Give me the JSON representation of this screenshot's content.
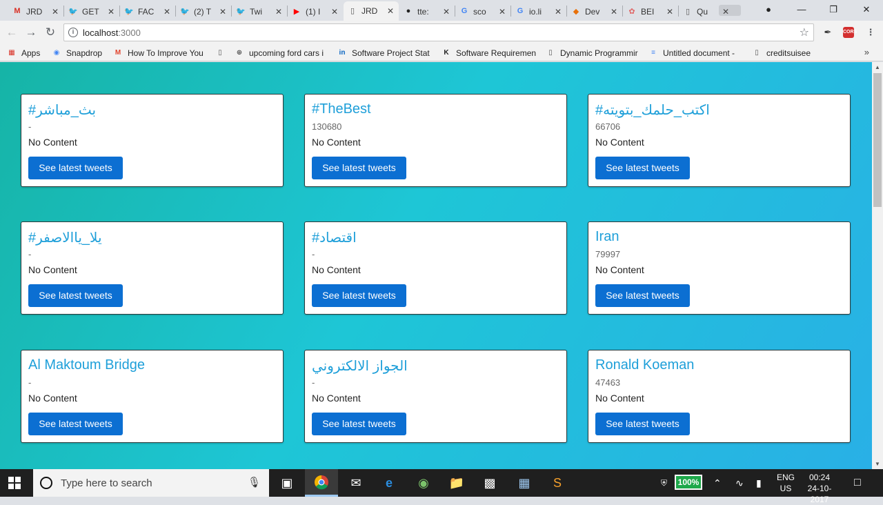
{
  "tabs": [
    {
      "title": "JRD",
      "icon": "M",
      "icon_color": "#d93025"
    },
    {
      "title": "GET",
      "icon": "🐦",
      "icon_color": "#1da1f2"
    },
    {
      "title": "FAC",
      "icon": "🐦",
      "icon_color": "#1da1f2"
    },
    {
      "title": "(2) T",
      "icon": "🐦",
      "icon_color": "#1da1f2"
    },
    {
      "title": "Twi",
      "icon": "🐦",
      "icon_color": "#1da1f2"
    },
    {
      "title": "(1) I",
      "icon": "▶",
      "icon_color": "#ff0000"
    },
    {
      "title": "JRD",
      "icon": "▯",
      "icon_color": "#555"
    },
    {
      "title": "tte:",
      "icon": "●",
      "icon_color": "#222"
    },
    {
      "title": "sco",
      "icon": "G",
      "icon_color": "#4285f4"
    },
    {
      "title": "io.li",
      "icon": "G",
      "icon_color": "#4285f4"
    },
    {
      "title": "Dev",
      "icon": "◆",
      "icon_color": "#e8710a"
    },
    {
      "title": "BEI",
      "icon": "✿",
      "icon_color": "#e06666"
    },
    {
      "title": "Qu",
      "icon": "▯",
      "icon_color": "#555"
    }
  ],
  "omnibox": {
    "host": "localhost",
    "path": ":3000"
  },
  "extensions": {
    "cors": "CORS"
  },
  "bookmarks": [
    {
      "label": "Apps",
      "icon": "▦",
      "icon_color": "#d93025"
    },
    {
      "label": "Snapdrop",
      "icon": "◉",
      "icon_color": "#4285f4"
    },
    {
      "label": "How To Improve You",
      "icon": "M",
      "icon_color": "#e2452e"
    },
    {
      "label": "",
      "icon": "▯",
      "icon_color": "#555"
    },
    {
      "label": "upcoming ford cars i",
      "icon": "⊕",
      "icon_color": "#555"
    },
    {
      "label": "Software Project Stat",
      "icon": "in",
      "icon_color": "#0a66c2"
    },
    {
      "label": "Software Requiremen",
      "icon": "K",
      "icon_color": "#222"
    },
    {
      "label": "Dynamic Programmir",
      "icon": "▯",
      "icon_color": "#555"
    },
    {
      "label": "Untitled document -",
      "icon": "≡",
      "icon_color": "#4285f4"
    },
    {
      "label": "creditsuisee",
      "icon": "▯",
      "icon_color": "#555"
    }
  ],
  "cards": [
    {
      "title": "#بث_مباشر",
      "count": "-",
      "content": "No Content",
      "button": "See latest tweets"
    },
    {
      "title": "#TheBest",
      "count": "130680",
      "content": "No Content",
      "button": "See latest tweets"
    },
    {
      "title": "#اكتب_حلمك_بتويته",
      "count": "66706",
      "content": "No Content",
      "button": "See latest tweets"
    },
    {
      "title": "#يلا_ياالاصفر",
      "count": "-",
      "content": "No Content",
      "button": "See latest tweets"
    },
    {
      "title": "#اقتصاد",
      "count": "-",
      "content": "No Content",
      "button": "See latest tweets"
    },
    {
      "title": "Iran",
      "count": "79997",
      "content": "No Content",
      "button": "See latest tweets"
    },
    {
      "title": "Al Maktoum Bridge",
      "count": "-",
      "content": "No Content",
      "button": "See latest tweets"
    },
    {
      "title": "الجواز الالكتروني",
      "count": "-",
      "content": "No Content",
      "button": "See latest tweets"
    },
    {
      "title": "Ronald Koeman",
      "count": "47463",
      "content": "No Content",
      "button": "See latest tweets"
    }
  ],
  "taskbar": {
    "search_placeholder": "Type here to search",
    "battery": "100%",
    "lang_top": "ENG",
    "lang_bottom": "US",
    "time": "00:24",
    "date": "24-10-2017"
  }
}
